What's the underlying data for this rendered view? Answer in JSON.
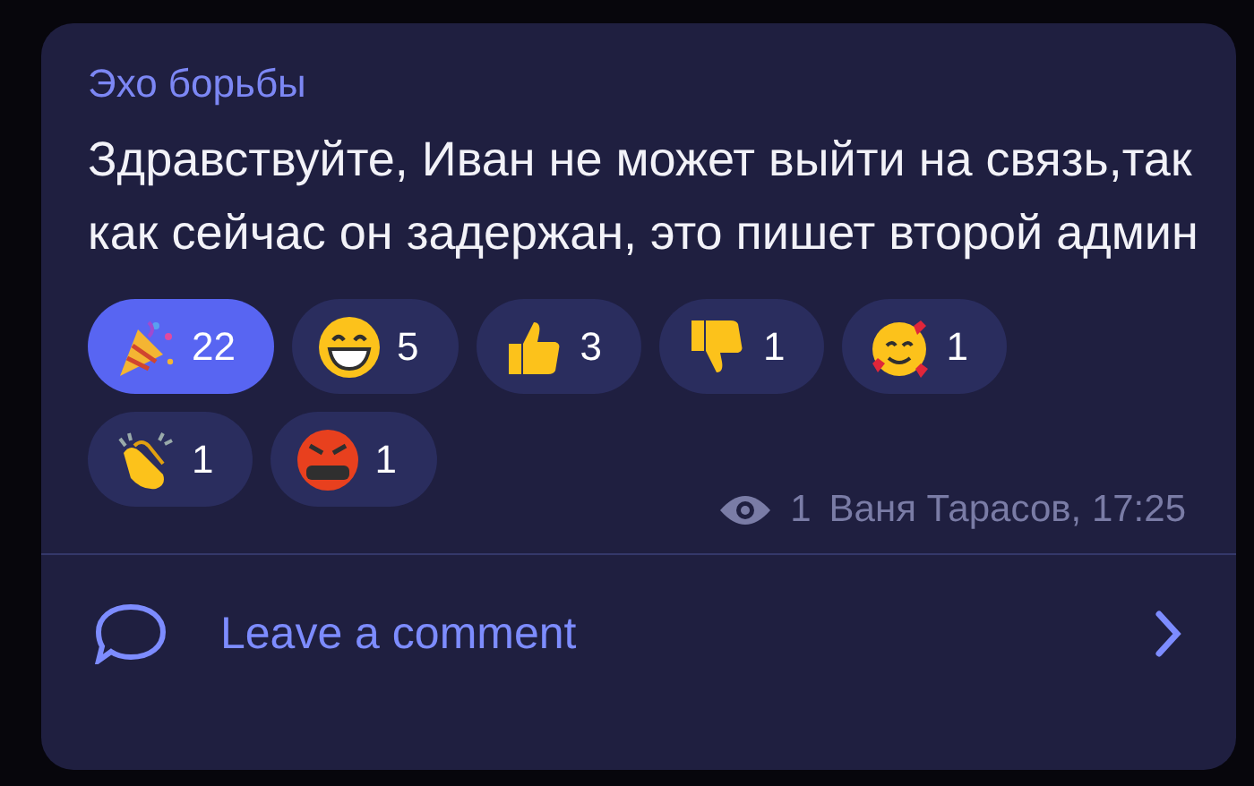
{
  "post": {
    "channel": "Эхо борьбы",
    "text": "Здравствуйте, Иван не может выйти на связь,так как сейчас он задержан, это пишет второй админ",
    "reactions": [
      {
        "kind": "party",
        "count": "22",
        "selected": true
      },
      {
        "kind": "grin",
        "count": "5",
        "selected": false
      },
      {
        "kind": "thumbsup",
        "count": "3",
        "selected": false
      },
      {
        "kind": "thumbsdown",
        "count": "1",
        "selected": false
      },
      {
        "kind": "hearts",
        "count": "1",
        "selected": false
      },
      {
        "kind": "clap",
        "count": "1",
        "selected": false
      },
      {
        "kind": "angry",
        "count": "1",
        "selected": false
      }
    ],
    "views": "1",
    "signature": "Ваня Тарасов, 17:25"
  },
  "comment_bar": {
    "label": "Leave a comment"
  }
}
